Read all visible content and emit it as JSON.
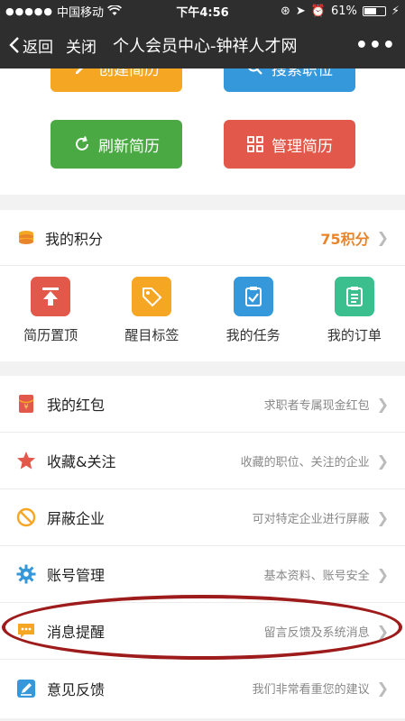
{
  "status": {
    "carrier": "中国移动",
    "time": "下午4:56",
    "battery": "61%",
    "battery_level": 0.61
  },
  "nav": {
    "back": "返回",
    "close": "关闭",
    "title": "个人会员中心-钟祥人才网",
    "more": "•••"
  },
  "top_buttons": [
    {
      "label": "创建简历",
      "color": "#f5a623"
    },
    {
      "label": "搜索职位",
      "color": "#3498db"
    },
    {
      "label": "刷新简历",
      "color": "#4aa942"
    },
    {
      "label": "管理简历",
      "color": "#e2584a"
    }
  ],
  "points": {
    "label": "我的积分",
    "value": "75积分"
  },
  "grid": [
    {
      "label": "简历置顶",
      "icon": "top-arrow-icon",
      "color": "#e2584a"
    },
    {
      "label": "醒目标签",
      "icon": "tag-icon",
      "color": "#f5a623"
    },
    {
      "label": "我的任务",
      "icon": "task-icon",
      "color": "#3498db"
    },
    {
      "label": "我的订单",
      "icon": "order-icon",
      "color": "#3bbf8f"
    }
  ],
  "list": [
    {
      "title": "我的红包",
      "desc": "求职者专属现金红包",
      "icon": "red-envelope-icon"
    },
    {
      "title": "收藏&关注",
      "desc": "收藏的职位、关注的企业",
      "icon": "star-icon"
    },
    {
      "title": "屏蔽企业",
      "desc": "可对特定企业进行屏蔽",
      "icon": "block-icon"
    },
    {
      "title": "账号管理",
      "desc": "基本资料、账号安全",
      "icon": "gear-icon"
    },
    {
      "title": "消息提醒",
      "desc": "留言反馈及系统消息",
      "icon": "message-icon"
    },
    {
      "title": "意见反馈",
      "desc": "我们非常看重您的建议",
      "icon": "feedback-icon"
    }
  ]
}
